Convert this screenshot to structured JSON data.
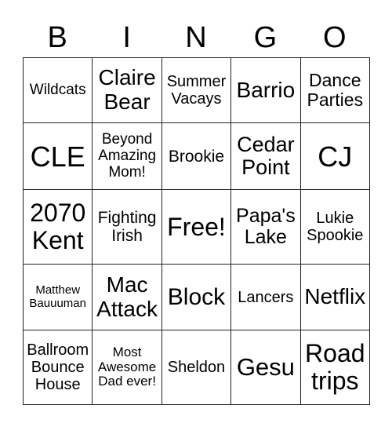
{
  "header": [
    "B",
    "I",
    "N",
    "G",
    "O"
  ],
  "cells": [
    [
      {
        "t": "Wildcats",
        "s": 19
      },
      {
        "t": "Claire Bear",
        "s": 28
      },
      {
        "t": "Summer Vacays",
        "s": 20
      },
      {
        "t": "Barrio",
        "s": 28
      },
      {
        "t": "Dance Parties",
        "s": 23
      }
    ],
    [
      {
        "t": "CLE",
        "s": 36
      },
      {
        "t": "Beyond Amazing Mom!",
        "s": 19
      },
      {
        "t": "Brookie",
        "s": 21
      },
      {
        "t": "Cedar Point",
        "s": 27
      },
      {
        "t": "CJ",
        "s": 36
      }
    ],
    [
      {
        "t": "2070 Kent",
        "s": 32
      },
      {
        "t": "Fighting Irish",
        "s": 21
      },
      {
        "t": "Free!",
        "s": 32
      },
      {
        "t": "Papa's Lake",
        "s": 25
      },
      {
        "t": "Lukie Spookie",
        "s": 20
      }
    ],
    [
      {
        "t": "Matthew Bauuuman",
        "s": 15
      },
      {
        "t": "Mac Attack",
        "s": 28
      },
      {
        "t": "Block",
        "s": 30
      },
      {
        "t": "Lancers",
        "s": 20
      },
      {
        "t": "Netflix",
        "s": 28
      }
    ],
    [
      {
        "t": "Ballroom Bounce House",
        "s": 20
      },
      {
        "t": "Most Awesome Dad ever!",
        "s": 17
      },
      {
        "t": "Sheldon",
        "s": 20
      },
      {
        "t": "Gesu",
        "s": 31
      },
      {
        "t": "Road trips",
        "s": 32
      }
    ]
  ]
}
